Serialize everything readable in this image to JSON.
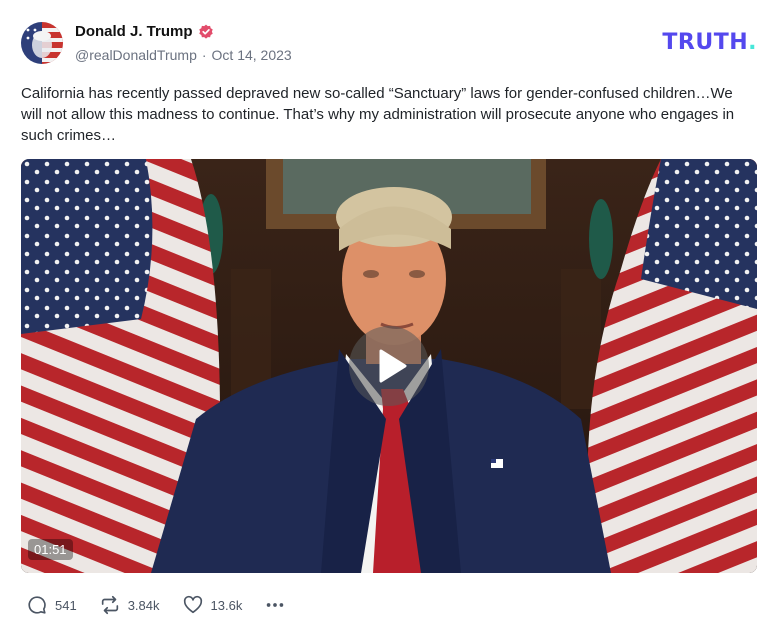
{
  "post": {
    "display_name": "Donald J. Trump",
    "handle": "@realDonaldTrump",
    "separator": "·",
    "date": "Oct 14, 2023",
    "text": "California has recently passed depraved new so-called “Sanctuary” laws for gender-confused children…We will not allow this madness to continue. That’s why my administration will prosecute anyone who engages in such crimes…"
  },
  "brand": {
    "logo_text": "TRUTH",
    "logo_dot": ".",
    "logo_color": "#5448ee",
    "dot_color": "#47e7d9"
  },
  "media": {
    "duration": "01:51"
  },
  "actions": {
    "replies": "541",
    "retruths": "3.84k",
    "likes": "13.6k"
  },
  "icons": {
    "verified": "verified-badge-icon",
    "play": "play-icon",
    "reply": "comment-bubble-icon",
    "retruth": "repost-arrows-icon",
    "like": "heart-icon",
    "more": "more-dots-icon"
  }
}
